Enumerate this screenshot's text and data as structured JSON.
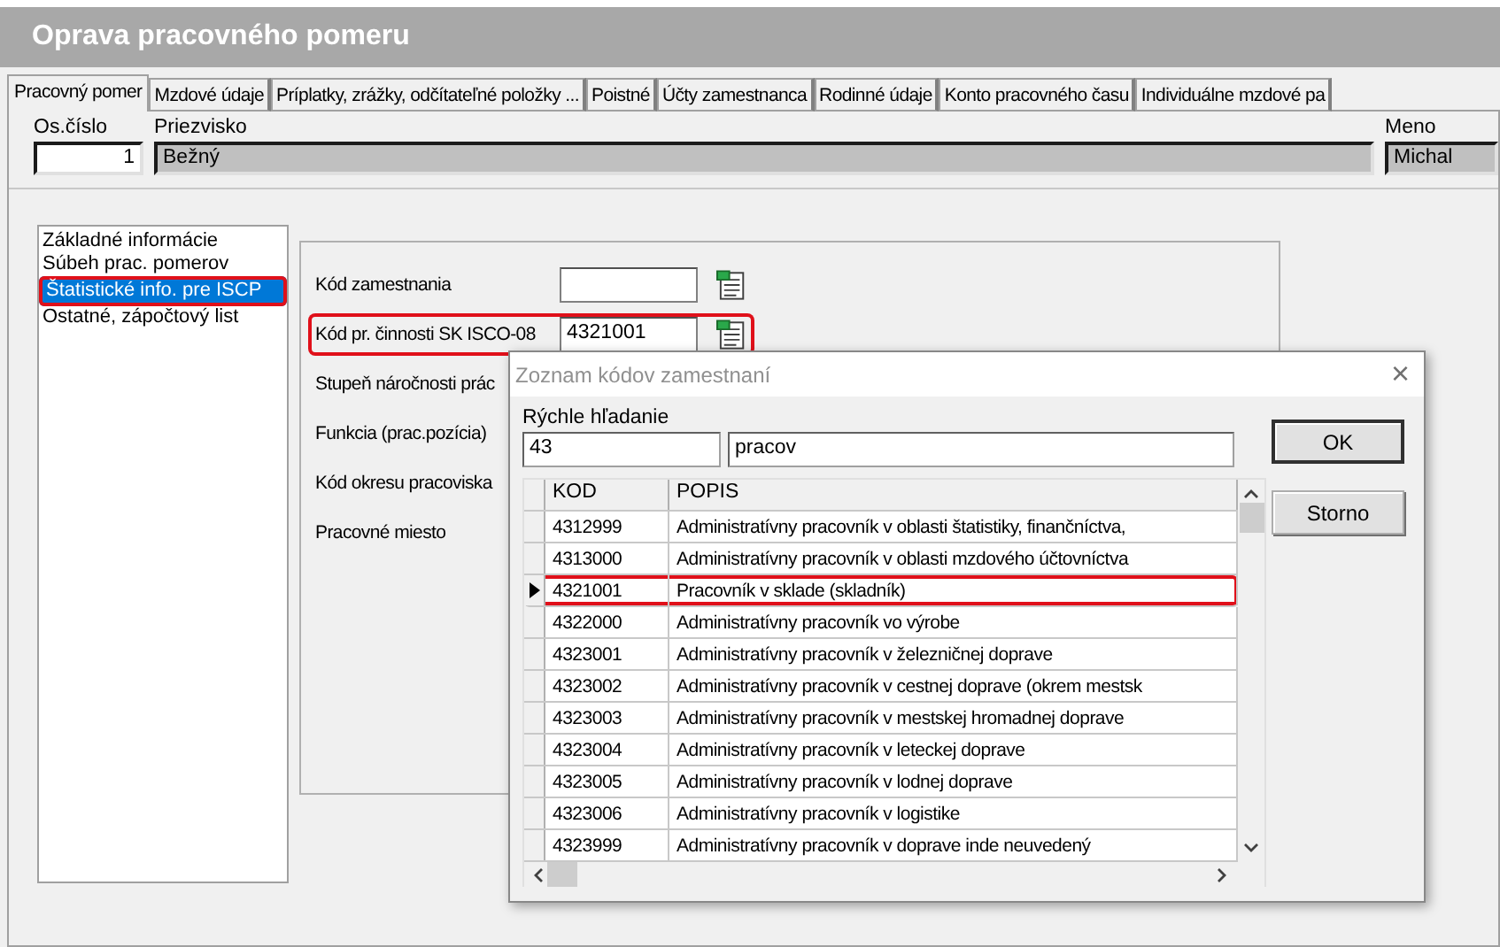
{
  "window": {
    "title": "Oprava pracovného pomeru"
  },
  "tabs": [
    {
      "label": "Pracovný pomer",
      "selected": true
    },
    {
      "label": "Mzdové údaje",
      "selected": false
    },
    {
      "label": "Príplatky, zrážky, odčítateľné položky ...",
      "selected": false
    },
    {
      "label": "Poistné",
      "selected": false
    },
    {
      "label": "Účty zamestnanca",
      "selected": false
    },
    {
      "label": "Rodinné údaje",
      "selected": false
    },
    {
      "label": "Konto pracovného času",
      "selected": false
    },
    {
      "label": "Individuálne mzdové pa",
      "selected": false
    }
  ],
  "header": {
    "fields": [
      {
        "label": "Os.číslo",
        "value": "1",
        "disabled": false
      },
      {
        "label": "Priezvisko",
        "value": "Bežný",
        "disabled": true
      },
      {
        "label": "Meno",
        "value": "Michal",
        "disabled": true
      }
    ]
  },
  "sections": [
    {
      "label": "Základné informácie",
      "selected": false,
      "highlighted": false
    },
    {
      "label": "Súbeh prac. pomerov",
      "selected": false,
      "highlighted": false
    },
    {
      "label": "Štatistické info. pre ISCP",
      "selected": true,
      "highlighted": true
    },
    {
      "label": "Ostatné, zápočtový list",
      "selected": false,
      "highlighted": false
    }
  ],
  "form": {
    "fields": [
      {
        "kind": "picker",
        "label": "Kód zamestnania",
        "highlighted": false
      },
      {
        "kind": "picker",
        "label": "Kód pr. činnosti SK ISCO-08",
        "value": "4321001",
        "highlighted": true
      },
      {
        "kind": "covered",
        "label": "Stupeň náročnosti prác",
        "highlighted": false
      },
      {
        "kind": "covered",
        "label": "Funkcia (prac.pozícia)",
        "highlighted": false
      },
      {
        "kind": "covered",
        "label": "Kód okresu pracoviska",
        "highlighted": false
      },
      {
        "kind": "covered",
        "label": "Pracovné miesto",
        "highlighted": false
      }
    ]
  },
  "dialog": {
    "title": "Zoznam kódov zamestnaní",
    "close": "×",
    "search_label": "Rýchle hľadanie",
    "search_code": "43",
    "search_text": "pracov",
    "columns": [
      "KOD",
      "POPIS"
    ],
    "rows": [
      {
        "code": "4312999",
        "description": "Administratívny pracovník v oblasti štatistiky, finančníctva,",
        "selected": false,
        "highlighted": false
      },
      {
        "code": "4313000",
        "description": "Administratívny pracovník v oblasti mzdového účtovníctva",
        "selected": false,
        "highlighted": false
      },
      {
        "code": "4321001",
        "description": "Pracovník v sklade (skladník)",
        "selected": true,
        "highlighted": true
      },
      {
        "code": "4322000",
        "description": "Administratívny pracovník vo výrobe",
        "selected": false,
        "highlighted": false
      },
      {
        "code": "4323001",
        "description": "Administratívny pracovník v železničnej doprave",
        "selected": false,
        "highlighted": false
      },
      {
        "code": "4323002",
        "description": "Administratívny pracovník v cestnej doprave (okrem mestsk",
        "selected": false,
        "highlighted": false
      },
      {
        "code": "4323003",
        "description": "Administratívny pracovník v mestskej hromadnej doprave",
        "selected": false,
        "highlighted": false
      },
      {
        "code": "4323004",
        "description": "Administratívny pracovník v leteckej doprave",
        "selected": false,
        "highlighted": false
      },
      {
        "code": "4323005",
        "description": "Administratívny pracovník v lodnej doprave",
        "selected": false,
        "highlighted": false
      },
      {
        "code": "4323006",
        "description": "Administratívny pracovník v logistike",
        "selected": false,
        "highlighted": false
      },
      {
        "code": "4323999",
        "description": "Administratívny pracovník v doprave inde neuvedený",
        "selected": false,
        "highlighted": false
      }
    ],
    "buttons": [
      {
        "label": "OK",
        "default": true
      },
      {
        "label": "Storno",
        "default": false
      }
    ]
  }
}
